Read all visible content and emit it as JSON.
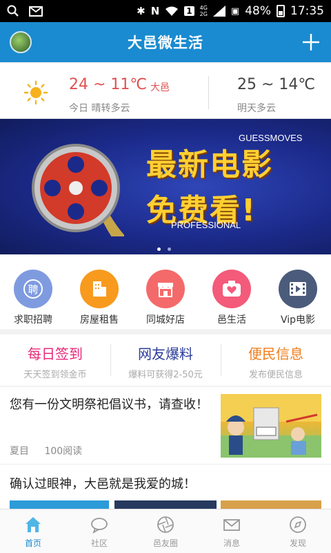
{
  "status_bar": {
    "battery": "48%",
    "time": "17:35",
    "network_top": "4G",
    "network_bottom": "2G",
    "sim": "1"
  },
  "titlebar": {
    "title": "大邑微生活"
  },
  "weather": {
    "today_temp": "24 ~ 11℃",
    "city": "大邑",
    "today_desc": "今日 晴转多云",
    "tomorrow_temp": "25 ~ 14℃",
    "tomorrow_desc": "明天多云"
  },
  "banner": {
    "line1": "最新电影",
    "line2": "免费看!",
    "tag1": "GUESSMOVES",
    "tag2": "PROFESSIONAL"
  },
  "categories": [
    {
      "label": "求职招聘",
      "icon": "hire-icon",
      "color": "#6d8fd6"
    },
    {
      "label": "房屋租售",
      "icon": "building-icon",
      "color": "#f5a623"
    },
    {
      "label": "同城好店",
      "icon": "shop-icon",
      "color": "#f46a6a"
    },
    {
      "label": "邑生活",
      "icon": "heart-camera-icon",
      "color": "#f45a7a"
    },
    {
      "label": "Vip电影",
      "icon": "film-icon",
      "color": "#4a5a7a"
    }
  ],
  "quick": [
    {
      "title": "每日签到",
      "sub": "天天签到领金币",
      "color": "#e8297a"
    },
    {
      "title": "网友爆料",
      "sub": "爆料可获得2-50元",
      "color": "#2a3b9a"
    },
    {
      "title": "便民信息",
      "sub": "发布便民信息",
      "color": "#f07d1a"
    }
  ],
  "news": [
    {
      "title": "您有一份文明祭祀倡议书，请查收！",
      "author": "夏目",
      "reads": "100阅读"
    },
    {
      "title": "确认过眼神，大邑就是我爱的城！"
    }
  ],
  "tabs": [
    {
      "label": "首页",
      "icon": "home-icon",
      "active": true
    },
    {
      "label": "社区",
      "icon": "chat-bubble-icon",
      "active": false
    },
    {
      "label": "邑友圈",
      "icon": "aperture-icon",
      "active": false
    },
    {
      "label": "消息",
      "icon": "mail-icon",
      "active": false
    },
    {
      "label": "发现",
      "icon": "compass-icon",
      "active": false
    }
  ]
}
